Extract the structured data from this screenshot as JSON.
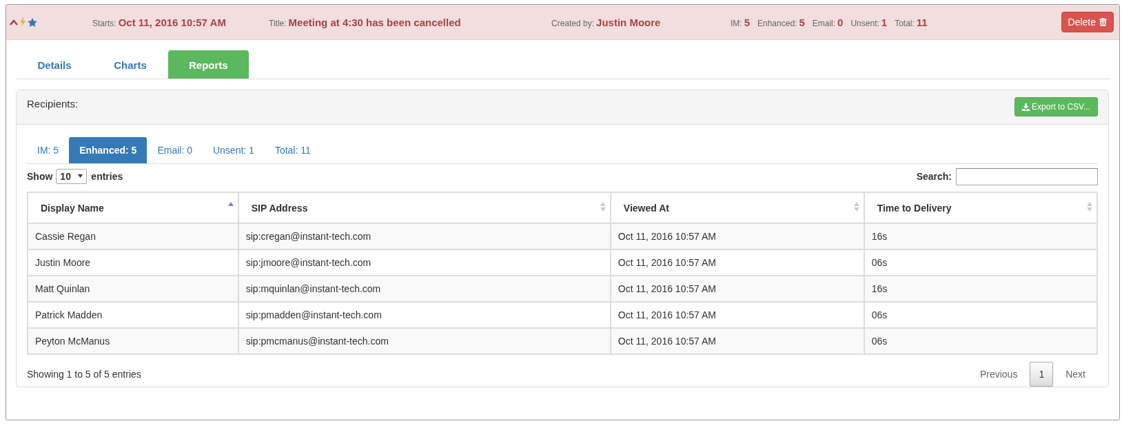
{
  "header": {
    "starts_label": "Starts:",
    "starts": "Oct 11, 2016 10:57 AM",
    "title_label": "Title:",
    "title": "Meeting at 4:30 has been cancelled",
    "created_label": "Created by:",
    "created_by": "Justin Moore",
    "counts": [
      {
        "label": "IM:",
        "value": "5"
      },
      {
        "label": "Enhanced:",
        "value": "5"
      },
      {
        "label": "Email:",
        "value": "0"
      },
      {
        "label": "Unsent:",
        "value": "1"
      },
      {
        "label": "Total:",
        "value": "11"
      }
    ],
    "delete_button": "Delete"
  },
  "tabs": [
    {
      "label": "Details",
      "selected": false
    },
    {
      "label": "Charts",
      "selected": false
    },
    {
      "label": "Reports",
      "selected": true
    }
  ],
  "panel": {
    "title": "Recipients:",
    "export_button": "Export to CSV...",
    "filter_tabs": [
      {
        "label": "IM: 5",
        "selected": false
      },
      {
        "label": "Enhanced: 5",
        "selected": true
      },
      {
        "label": "Email: 0",
        "selected": false
      },
      {
        "label": "Unsent: 1",
        "selected": false
      },
      {
        "label": "Total: 11",
        "selected": false
      }
    ],
    "show_label": "Show",
    "page_size": "10",
    "entries_label": "entries",
    "search_label": "Search:",
    "table": {
      "columns": [
        {
          "label": "Display Name",
          "sorted": true
        },
        {
          "label": "SIP Address",
          "sorted": false
        },
        {
          "label": "Viewed At",
          "sorted": false
        },
        {
          "label": "Time to Delivery",
          "sorted": false
        }
      ],
      "rows": [
        [
          "Cassie Regan",
          "sip:cregan@instant-tech.com",
          "Oct 11, 2016 10:57 AM",
          "16s"
        ],
        [
          "Justin Moore",
          "sip:jmoore@instant-tech.com",
          "Oct 11, 2016 10:57 AM",
          "06s"
        ],
        [
          "Matt Quinlan",
          "sip:mquinlan@instant-tech.com",
          "Oct 11, 2016 10:57 AM",
          "16s"
        ],
        [
          "Patrick Madden",
          "sip:pmadden@instant-tech.com",
          "Oct 11, 2016 10:57 AM",
          "06s"
        ],
        [
          "Peyton McManus",
          "sip:pmcmanus@instant-tech.com",
          "Oct 11, 2016 10:57 AM",
          "06s"
        ]
      ]
    },
    "info": "Showing 1 to 5 of 5 entries",
    "pagination": [
      {
        "label": "Previous",
        "kind": "nav",
        "disabled": true,
        "selected": false
      },
      {
        "label": "1",
        "kind": "page",
        "disabled": false,
        "selected": true
      },
      {
        "label": "Next",
        "kind": "nav",
        "disabled": true,
        "selected": false
      }
    ]
  }
}
